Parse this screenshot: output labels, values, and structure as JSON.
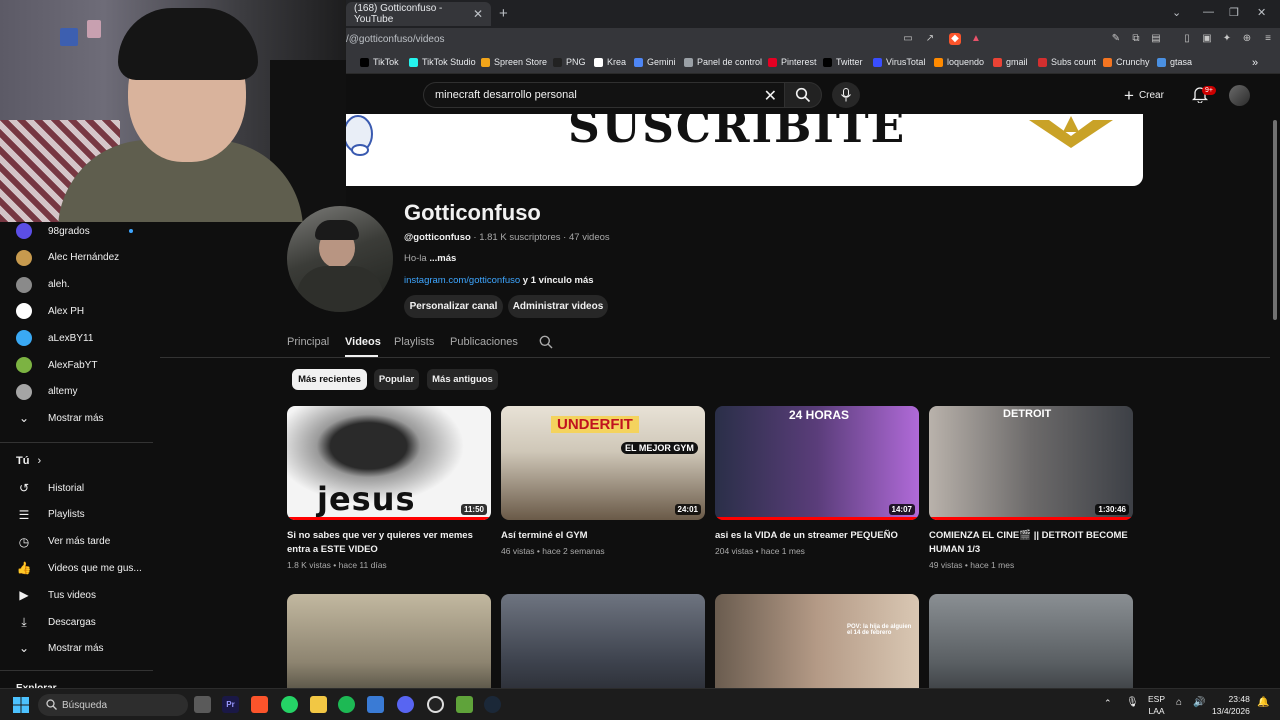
{
  "browser": {
    "tab_title": "(168) Gotticonfuso - YouTube",
    "url": "/@gotticonfuso/videos",
    "bookmarks": [
      {
        "label": "TikTok",
        "color": "#000000"
      },
      {
        "label": "TikTok Studio",
        "color": "#25f4ee"
      },
      {
        "label": "Spreen Store",
        "color": "#f2a51a"
      },
      {
        "label": "PNG",
        "color": "#222222"
      },
      {
        "label": "Krea",
        "color": "#ffffff"
      },
      {
        "label": "Gemini",
        "color": "#4e86f5"
      },
      {
        "label": "Panel de control",
        "color": "#9aa0a6"
      },
      {
        "label": "Pinterest",
        "color": "#e60023"
      },
      {
        "label": "Twitter",
        "color": "#000000"
      },
      {
        "label": "VirusTotal",
        "color": "#394eff"
      },
      {
        "label": "loquendo",
        "color": "#ff8a00"
      },
      {
        "label": "gmail",
        "color": "#ea4335"
      },
      {
        "label": "Subs count",
        "color": "#d32f2f"
      },
      {
        "label": "Crunchy",
        "color": "#f47521"
      },
      {
        "label": "gtasa",
        "color": "#4a90e2"
      }
    ]
  },
  "header": {
    "search_value": "minecraft desarrollo personal",
    "create_label": "Crear",
    "notif_badge": "9+"
  },
  "sidebar": {
    "subscriptions": [
      {
        "label": "98grados",
        "color": "#5b4ee6",
        "has_dot": true
      },
      {
        "label": "Alec Hernández",
        "color": "#c79a4e",
        "has_dot": false
      },
      {
        "label": "aleh.",
        "color": "#8a8a8a",
        "has_dot": false
      },
      {
        "label": "Alex PH",
        "color": "#ffffff",
        "has_dot": false
      },
      {
        "label": "aLexBY11",
        "color": "#3aa9f4",
        "has_dot": false
      },
      {
        "label": "AlexFabYT",
        "color": "#7cb342",
        "has_dot": false
      },
      {
        "label": "altemy",
        "color": "#a5a5a5",
        "has_dot": false
      }
    ],
    "show_more": "Mostrar más",
    "you_label": "Tú",
    "you_items": [
      {
        "label": "Historial",
        "icon": "history-icon"
      },
      {
        "label": "Playlists",
        "icon": "playlists-icon"
      },
      {
        "label": "Ver más tarde",
        "icon": "watch-later-icon"
      },
      {
        "label": "Videos que me gus...",
        "icon": "like-icon"
      },
      {
        "label": "Tus videos",
        "icon": "your-videos-icon"
      },
      {
        "label": "Descargas",
        "icon": "download-icon"
      }
    ],
    "show_more_2": "Mostrar más",
    "explore_label": "Explorar"
  },
  "banner": {
    "text": "SUSCRIBITE"
  },
  "channel": {
    "name": "Gotticonfuso",
    "handle": "@gotticonfuso",
    "stats": " · 1.81 K suscriptores · 47 videos",
    "desc": "Ho-la ",
    "desc_more": "...más",
    "link": "instagram.com/gotticonfuso",
    "link_more": " y 1 vínculo más",
    "btn_customize": "Personalizar canal",
    "btn_manage": "Administrar videos"
  },
  "tabs": [
    {
      "label": "Principal",
      "active": false
    },
    {
      "label": "Videos",
      "active": true
    },
    {
      "label": "Playlists",
      "active": false
    },
    {
      "label": "Publicaciones",
      "active": false
    }
  ],
  "chips": [
    {
      "label": "Más recientes",
      "selected": true
    },
    {
      "label": "Popular",
      "selected": false
    },
    {
      "label": "Más antiguos",
      "selected": false
    }
  ],
  "videos": [
    {
      "title": "Si no sabes que ver y quieres ver memes entra a ESTE VIDEO",
      "views": "1.8 K vistas",
      "age": "hace 11 días",
      "duration": "11:50",
      "watched": 1.0,
      "thumb_text": "jesus"
    },
    {
      "title": "Así terminé el GYM",
      "views": "46 vistas",
      "age": "hace 2 semanas",
      "duration": "24:01",
      "watched": 0.0,
      "thumb_text": "UNDERFIT",
      "thumb_text_2": "EL MEJOR GYM"
    },
    {
      "title": "asi es la VIDA de un streamer PEQUEÑO",
      "views": "204 vistas",
      "age": "hace 1 mes",
      "duration": "14:07",
      "watched": 1.0,
      "thumb_text": "24 HORAS"
    },
    {
      "title": "COMIENZA EL CINE🎬 || DETROIT BECOME HUMAN 1/3",
      "views": "49 vistas",
      "age": "hace 1 mes",
      "duration": "1:30:46",
      "watched": 1.0,
      "thumb_text": "DETROIT"
    },
    {
      "title": "",
      "views": "",
      "age": "",
      "duration": "",
      "watched": 0.0,
      "thumb_text": ""
    },
    {
      "title": "",
      "views": "",
      "age": "",
      "duration": "",
      "watched": 0.0,
      "thumb_text": ""
    },
    {
      "title": "",
      "views": "",
      "age": "",
      "duration": "",
      "watched": 0.0,
      "thumb_text": "POV: la hija de alguien el 14 de febrero"
    },
    {
      "title": "",
      "views": "",
      "age": "",
      "duration": "",
      "watched": 0.0,
      "thumb_text": ""
    }
  ],
  "taskbar": {
    "search_label": "Búsqueda",
    "lang_1": "ESP",
    "lang_2": "LAA",
    "time": "23:48",
    "date": "13/4/2026"
  }
}
